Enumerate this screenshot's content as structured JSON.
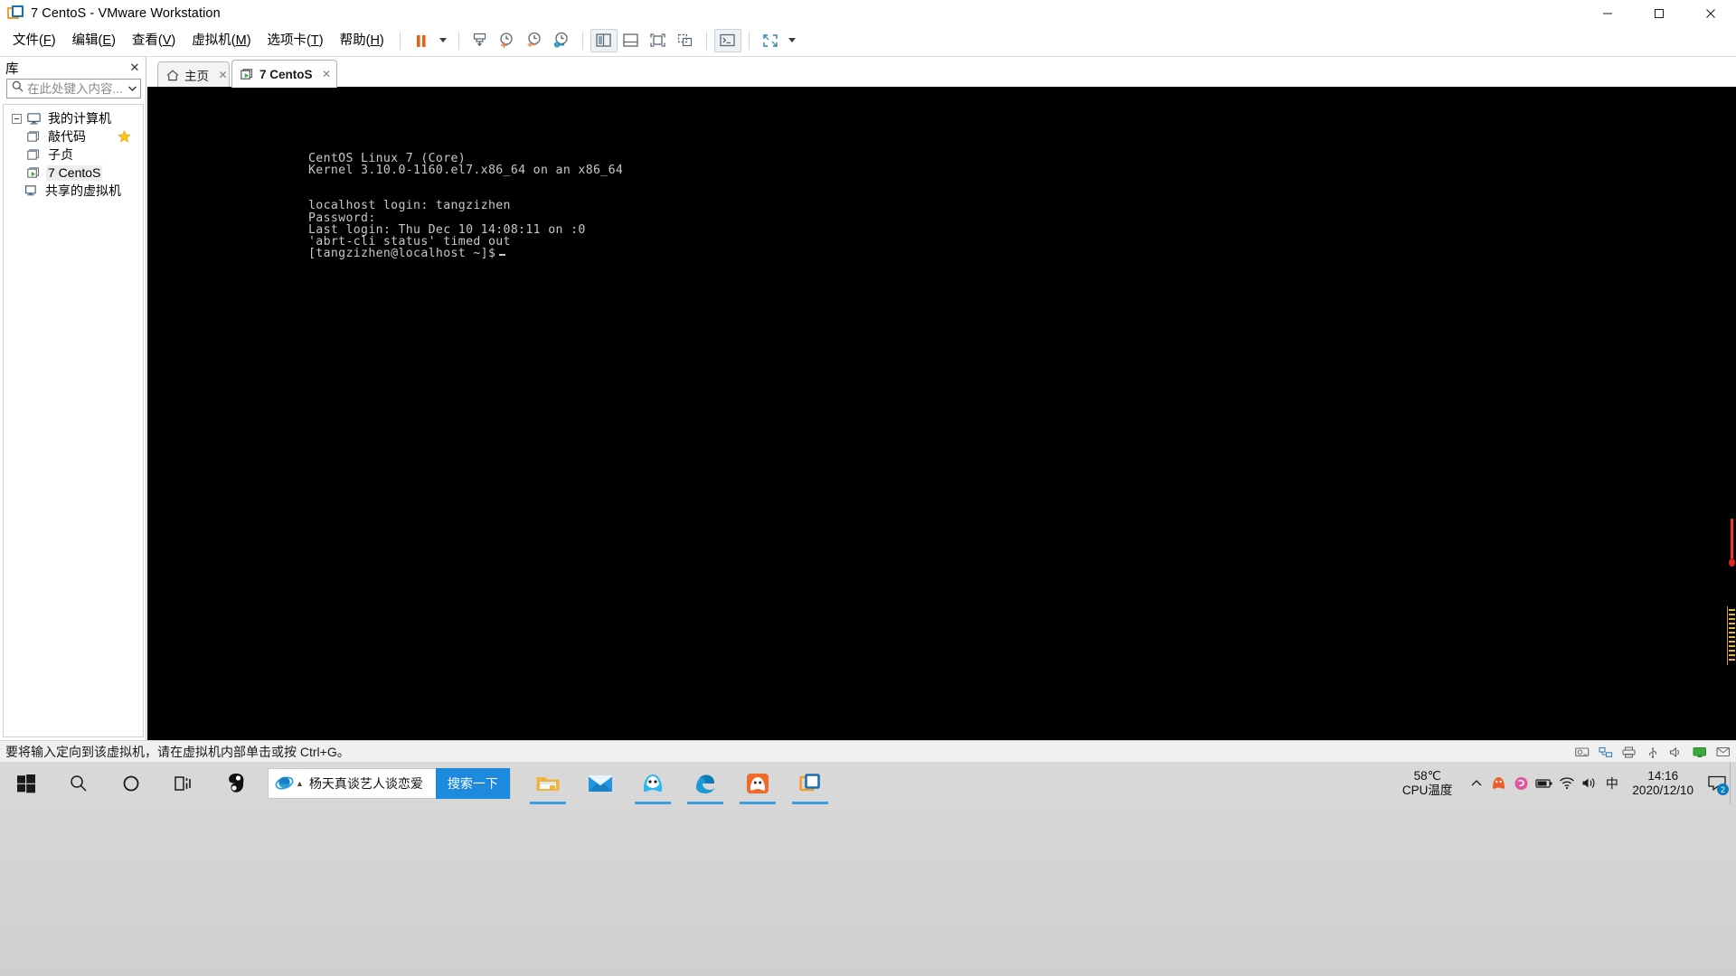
{
  "window": {
    "title": "7 CentoS - VMware Workstation",
    "app_icon": "vmware-icon",
    "minimize_label": "−",
    "maximize_label": "□",
    "close_label": "✕"
  },
  "menubar": {
    "items": [
      {
        "label": "文件",
        "mnemonic": "F"
      },
      {
        "label": "编辑",
        "mnemonic": "E"
      },
      {
        "label": "查看",
        "mnemonic": "V"
      },
      {
        "label": "虚拟机",
        "mnemonic": "M"
      },
      {
        "label": "选项卡",
        "mnemonic": "T"
      },
      {
        "label": "帮助",
        "mnemonic": "H"
      }
    ]
  },
  "toolbar": {
    "buttons": [
      {
        "name": "suspend-button",
        "icon": "pause-icon"
      },
      {
        "name": "power-dropdown",
        "icon": "chevron-down-icon"
      },
      {
        "name": "snapshot-manager-button",
        "icon": "snapshot-icon"
      },
      {
        "name": "take-snapshot-button",
        "icon": "clock-plus-icon"
      },
      {
        "name": "revert-snapshot-button",
        "icon": "clock-back-icon"
      },
      {
        "name": "manage-snapshots-button",
        "icon": "clock-wrench-icon"
      },
      {
        "name": "show-library-button",
        "icon": "sidebar-panel-icon"
      },
      {
        "name": "show-console-view-button",
        "icon": "bottom-panel-icon"
      },
      {
        "name": "full-screen-button",
        "icon": "fullscreen-icon"
      },
      {
        "name": "unity-mode-button",
        "icon": "unity-icon"
      },
      {
        "name": "console-button",
        "icon": "terminal-icon"
      },
      {
        "name": "stretch-button",
        "icon": "expand-arrows-icon"
      },
      {
        "name": "stretch-dropdown",
        "icon": "chevron-down-icon"
      }
    ]
  },
  "sidebar": {
    "title": "库",
    "close_label": "✕",
    "search": {
      "placeholder": "在此处键入内容...",
      "value": "",
      "icon": "search-icon",
      "dropdown_icon": "chevron-down-icon"
    },
    "tree": [
      {
        "label": "我的计算机",
        "icon": "monitor-icon",
        "level": 0,
        "expanded": true,
        "selected": false,
        "favorite": false
      },
      {
        "label": "敲代码",
        "icon": "vm-icon",
        "level": 1,
        "selected": false,
        "favorite": true
      },
      {
        "label": "子贞",
        "icon": "vm-icon",
        "level": 1,
        "selected": false,
        "favorite": false
      },
      {
        "label": "7 CentoS",
        "icon": "vm-running-icon",
        "level": 1,
        "selected": true,
        "favorite": false
      },
      {
        "label": "共享的虚拟机",
        "icon": "shared-vm-icon",
        "level": 0,
        "selected": false,
        "favorite": false
      }
    ]
  },
  "tabs": [
    {
      "label": "主页",
      "icon": "home-icon",
      "active": false,
      "close_label": "✕"
    },
    {
      "label": "7 CentoS",
      "icon": "vm-running-icon",
      "active": true,
      "close_label": "✕"
    }
  ],
  "terminal": {
    "lines": [
      "CentOS Linux 7 (Core)",
      "Kernel 3.10.0-1160.el7.x86_64 on an x86_64",
      "",
      "localhost login: tangzizhen",
      "Password:",
      "Last login: Thu Dec 10 14:08:11 on :0",
      "'abrt-cli status' timed out",
      "[tangzizhen@localhost ~]$"
    ],
    "cursor": "_",
    "fg_color": "#c8c8c8",
    "bg_color": "#000000"
  },
  "statusbar": {
    "message": "要将输入定向到该虚拟机，请在虚拟机内部单击或按 Ctrl+G。",
    "icons": [
      {
        "name": "hard-disk-icon"
      },
      {
        "name": "network-icon"
      },
      {
        "name": "printer-icon"
      },
      {
        "name": "usb-icon"
      },
      {
        "name": "sound-icon"
      },
      {
        "name": "display-icon"
      },
      {
        "name": "message-icon"
      }
    ]
  },
  "taskbar": {
    "start_icon": "windows-start-icon",
    "items": [
      {
        "name": "search-icon",
        "label": ""
      },
      {
        "name": "cortana-icon",
        "label": ""
      },
      {
        "name": "task-view-icon",
        "label": ""
      },
      {
        "name": "sogou-icon",
        "label": ""
      }
    ],
    "ie_search": {
      "icon": "internet-explorer-icon",
      "text": "杨天真谈艺人谈恋爱",
      "button_label": "搜索一下"
    },
    "pinned": [
      {
        "name": "file-explorer-icon",
        "running": true
      },
      {
        "name": "mail-icon",
        "running": false
      },
      {
        "name": "tim-icon",
        "running": true
      },
      {
        "name": "edge-icon",
        "running": true
      },
      {
        "name": "qq-browser-icon",
        "running": true
      },
      {
        "name": "vmware-icon",
        "running": true
      }
    ],
    "tray": {
      "cpu_temp_value": "58℃",
      "cpu_temp_label": "CPU温度",
      "chevron_icon": "chevron-up-icon",
      "icons": [
        {
          "name": "qq-tray-icon"
        },
        {
          "name": "sogou-tray-icon"
        },
        {
          "name": "battery-icon"
        },
        {
          "name": "wifi-icon"
        },
        {
          "name": "volume-icon"
        },
        {
          "name": "ime-icon",
          "label": "中"
        }
      ],
      "clock_time": "14:16",
      "clock_date": "2020/12/10",
      "notification_count": "2",
      "notification_icon": "chat-icon"
    }
  },
  "colors": {
    "accent": "#1e8ade",
    "vm_bg": "#000000",
    "vm_fg": "#c8c8c8",
    "taskbar_bg": "#d4d4d4",
    "vmware_orange": "#f0a030",
    "vmware_blue": "#1a6fb5"
  }
}
